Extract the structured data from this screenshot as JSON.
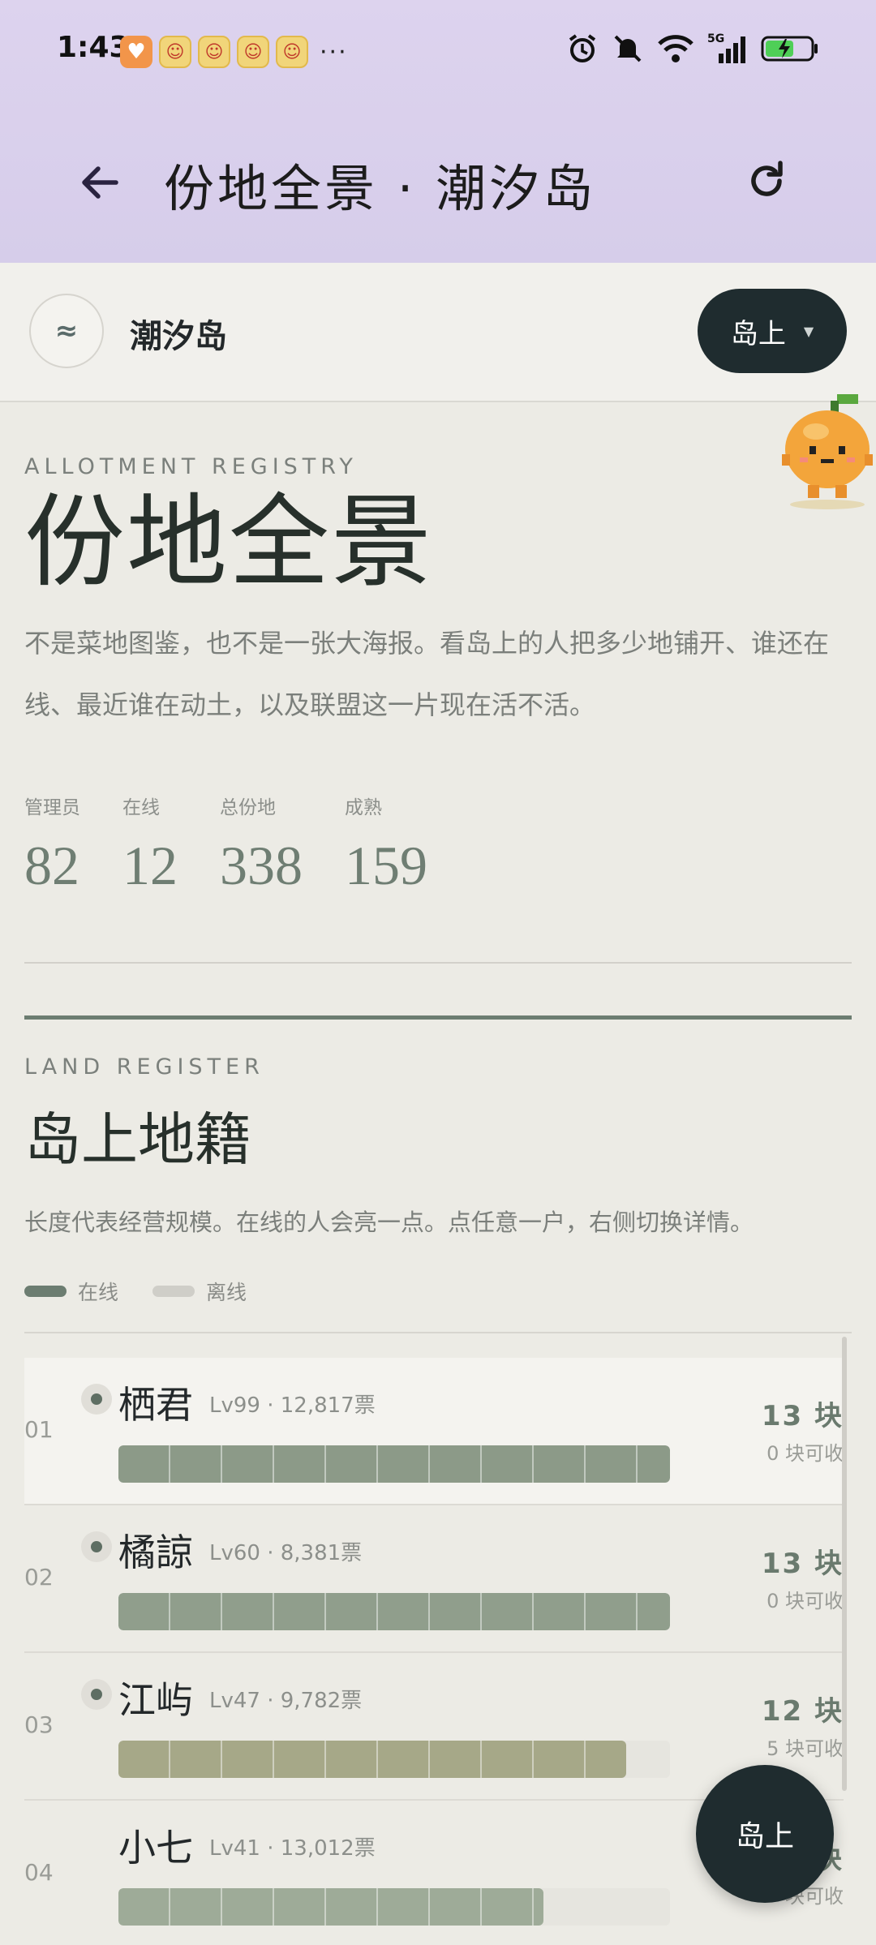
{
  "status_bar": {
    "time": "1:43",
    "more": "···",
    "network_label": "5G"
  },
  "app_bar": {
    "title": "份地全景 · 潮汐岛"
  },
  "island": {
    "logo_glyph": "≈",
    "name": "潮汐岛",
    "selector_label": "岛上"
  },
  "hero": {
    "eyebrow": "ALLOTMENT REGISTRY",
    "title": "份地全景",
    "description": "不是菜地图鉴，也不是一张大海报。看岛上的人把多少地铺开、谁还在线、最近谁在动土，以及联盟这一片现在活不活。"
  },
  "stats": [
    {
      "label": "管理员",
      "value": "82"
    },
    {
      "label": "在线",
      "value": "12"
    },
    {
      "label": "总份地",
      "value": "338"
    },
    {
      "label": "成熟",
      "value": "159"
    }
  ],
  "register": {
    "eyebrow": "LAND REGISTER",
    "title": "岛上地籍",
    "description": "长度代表经营规模。在线的人会亮一点。点任意一户，右侧切换详情。",
    "legend": [
      {
        "label": "在线",
        "color": "#6c7d71"
      },
      {
        "label": "离线",
        "color": "#cfcec8"
      }
    ]
  },
  "rows": [
    {
      "rank": "01",
      "name": "栖君",
      "meta": "Lv99 · 12,817票",
      "count": "13 块",
      "harvest": "0 块可收",
      "online": true,
      "fill": 1.0,
      "color": "#8c9a88"
    },
    {
      "rank": "02",
      "name": "橘諒",
      "meta": "Lv60 · 8,381票",
      "count": "13 块",
      "harvest": "0 块可收",
      "online": true,
      "fill": 1.0,
      "color": "#909e8c"
    },
    {
      "rank": "03",
      "name": "江屿",
      "meta": "Lv47 · 9,782票",
      "count": "12 块",
      "harvest": "5 块可收",
      "online": true,
      "fill": 0.92,
      "color": "#a6a888"
    },
    {
      "rank": "04",
      "name": "小七",
      "meta": "Lv41 · 13,012票",
      "count": "块",
      "harvest": "块可收",
      "online": false,
      "fill": 0.77,
      "color": "#9eab98"
    }
  ],
  "fab": {
    "label": "岛上"
  }
}
